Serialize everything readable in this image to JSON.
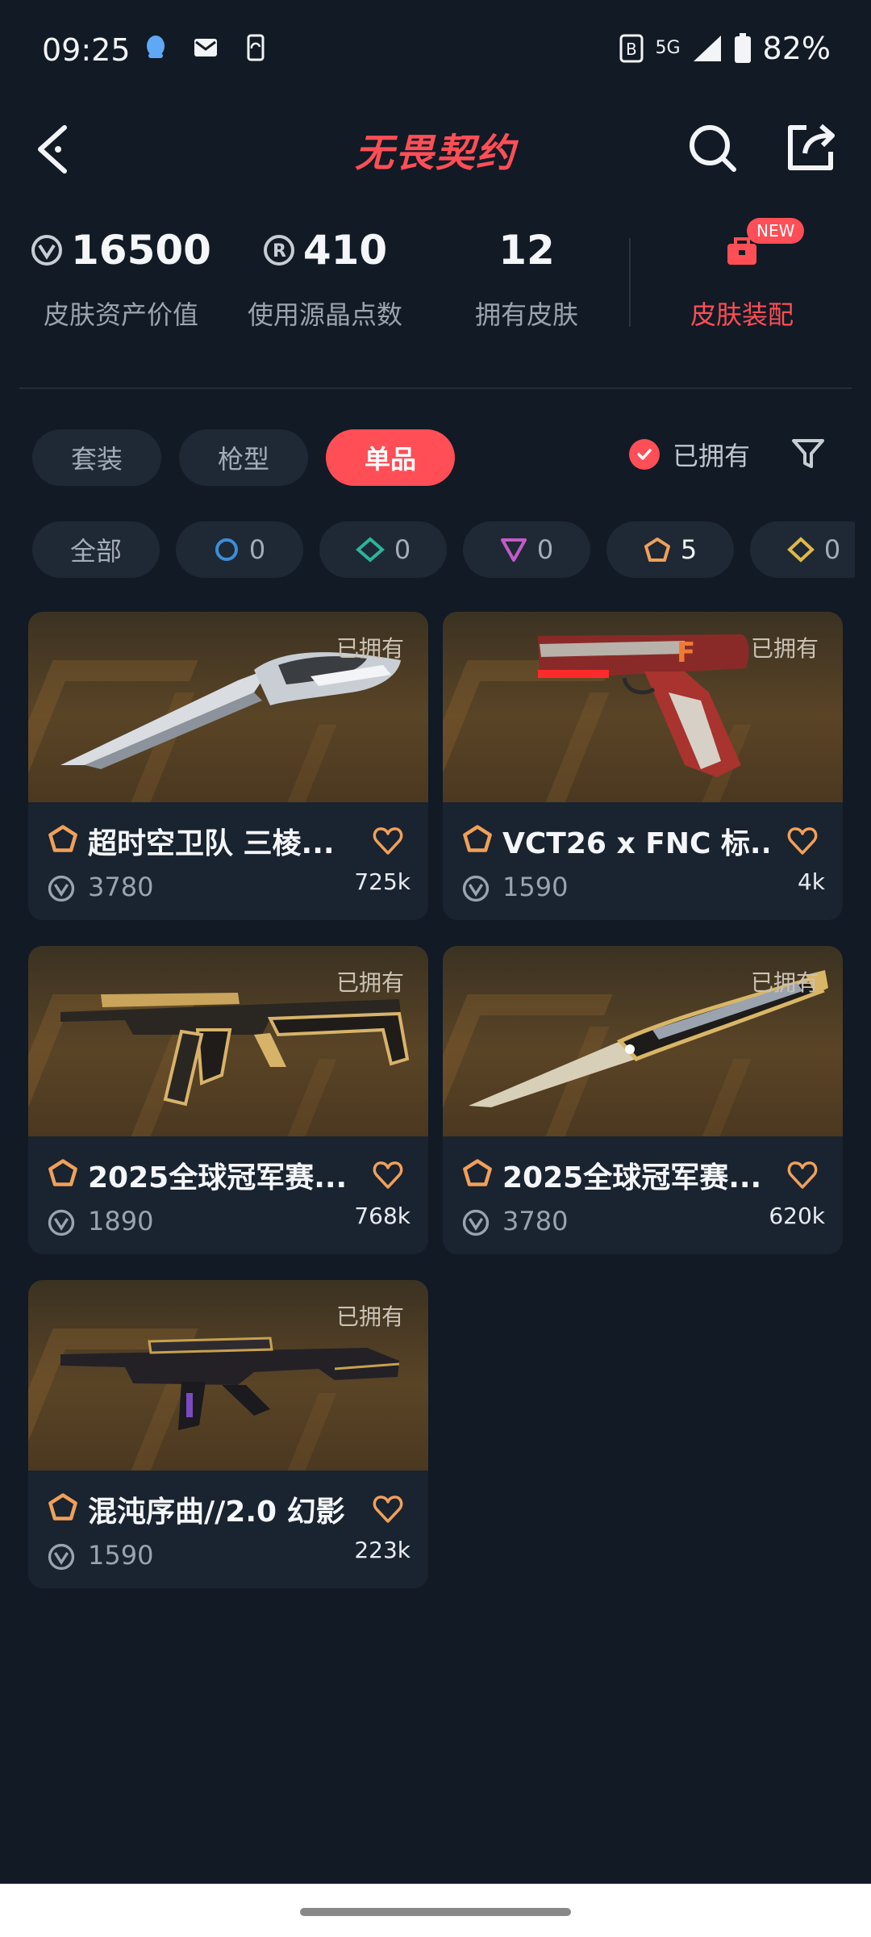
{
  "status_bar": {
    "time": "09:25",
    "battery": "82%",
    "network": "5G"
  },
  "header": {
    "logo": "无畏契约"
  },
  "stats": [
    {
      "value": "16500",
      "label": "皮肤资产价值"
    },
    {
      "value": "410",
      "label": "使用源晶点数"
    },
    {
      "value": "12",
      "label": "拥有皮肤"
    }
  ],
  "equip": {
    "label": "皮肤装配",
    "badge": "NEW"
  },
  "tabs": [
    "套装",
    "枪型",
    "单品"
  ],
  "active_tab": "单品",
  "owned_filter": {
    "label": "已拥有",
    "checked": true
  },
  "tiers": [
    {
      "label": "全部"
    },
    {
      "count": "0",
      "color": "#3b8ed8"
    },
    {
      "count": "0",
      "color": "#2bb59a"
    },
    {
      "count": "0",
      "color": "#c25bc8"
    },
    {
      "count": "5",
      "color": "#f0a05a"
    },
    {
      "count": "0",
      "color": "#e0b84a"
    }
  ],
  "skins": [
    {
      "name": "超时空卫队 三棱...",
      "price": "3780",
      "favorites": "725k",
      "owned": "已拥有"
    },
    {
      "name": "VCT26 x FNC 标...",
      "price": "1590",
      "favorites": "4k",
      "owned": "已拥有"
    },
    {
      "name": "2025全球冠军赛...",
      "price": "1890",
      "favorites": "768k",
      "owned": "已拥有"
    },
    {
      "name": "2025全球冠军赛...",
      "price": "3780",
      "favorites": "620k",
      "owned": "已拥有"
    },
    {
      "name": "混沌序曲//2.0 幻影",
      "price": "1590",
      "favorites": "223k",
      "owned": "已拥有"
    }
  ],
  "colors": {
    "accent": "#ff4e56",
    "background": "#111a25",
    "card": "#1a2330"
  }
}
